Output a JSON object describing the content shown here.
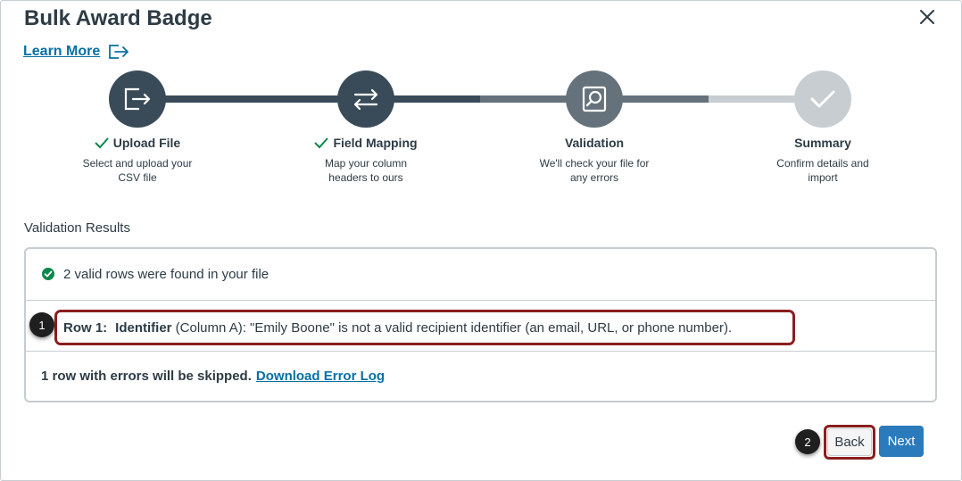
{
  "dialog": {
    "title": "Bulk Award Badge",
    "learn_more": "Learn More"
  },
  "colors": {
    "step_complete": "#394b58",
    "step_current": "#66727b",
    "step_pending": "#c7cdd1",
    "link": "#0770a3",
    "success": "#0b874b",
    "primary_button": "#2b7abc",
    "callout_outline": "#8b1e1e"
  },
  "steps": [
    {
      "title": "Upload File",
      "desc_line1": "Select and upload your",
      "desc_line2": "CSV file",
      "icon": "file-export-icon",
      "status": "complete"
    },
    {
      "title": "Field Mapping",
      "desc_line1": "Map your column",
      "desc_line2": "headers to ours",
      "icon": "arrows-swap-icon",
      "status": "complete"
    },
    {
      "title": "Validation",
      "desc_line1": "We'll check your file for",
      "desc_line2": "any errors",
      "icon": "search-file-icon",
      "status": "current"
    },
    {
      "title": "Summary",
      "desc_line1": "Confirm details and",
      "desc_line2": "import",
      "icon": "checkmark-icon",
      "status": "pending"
    }
  ],
  "results": {
    "heading": "Validation Results",
    "valid_message": "2 valid rows were found in your file",
    "error": {
      "row_label": "Row 1:",
      "field": "Identifier",
      "message": " (Column A): \"Emily Boone\" is not a valid recipient identifier (an email, URL, or phone number)."
    },
    "skip_message": "1 row with errors will be skipped.",
    "download_link": "Download Error Log"
  },
  "callouts": [
    "1",
    "2"
  ],
  "buttons": {
    "back": "Back",
    "next": "Next"
  }
}
